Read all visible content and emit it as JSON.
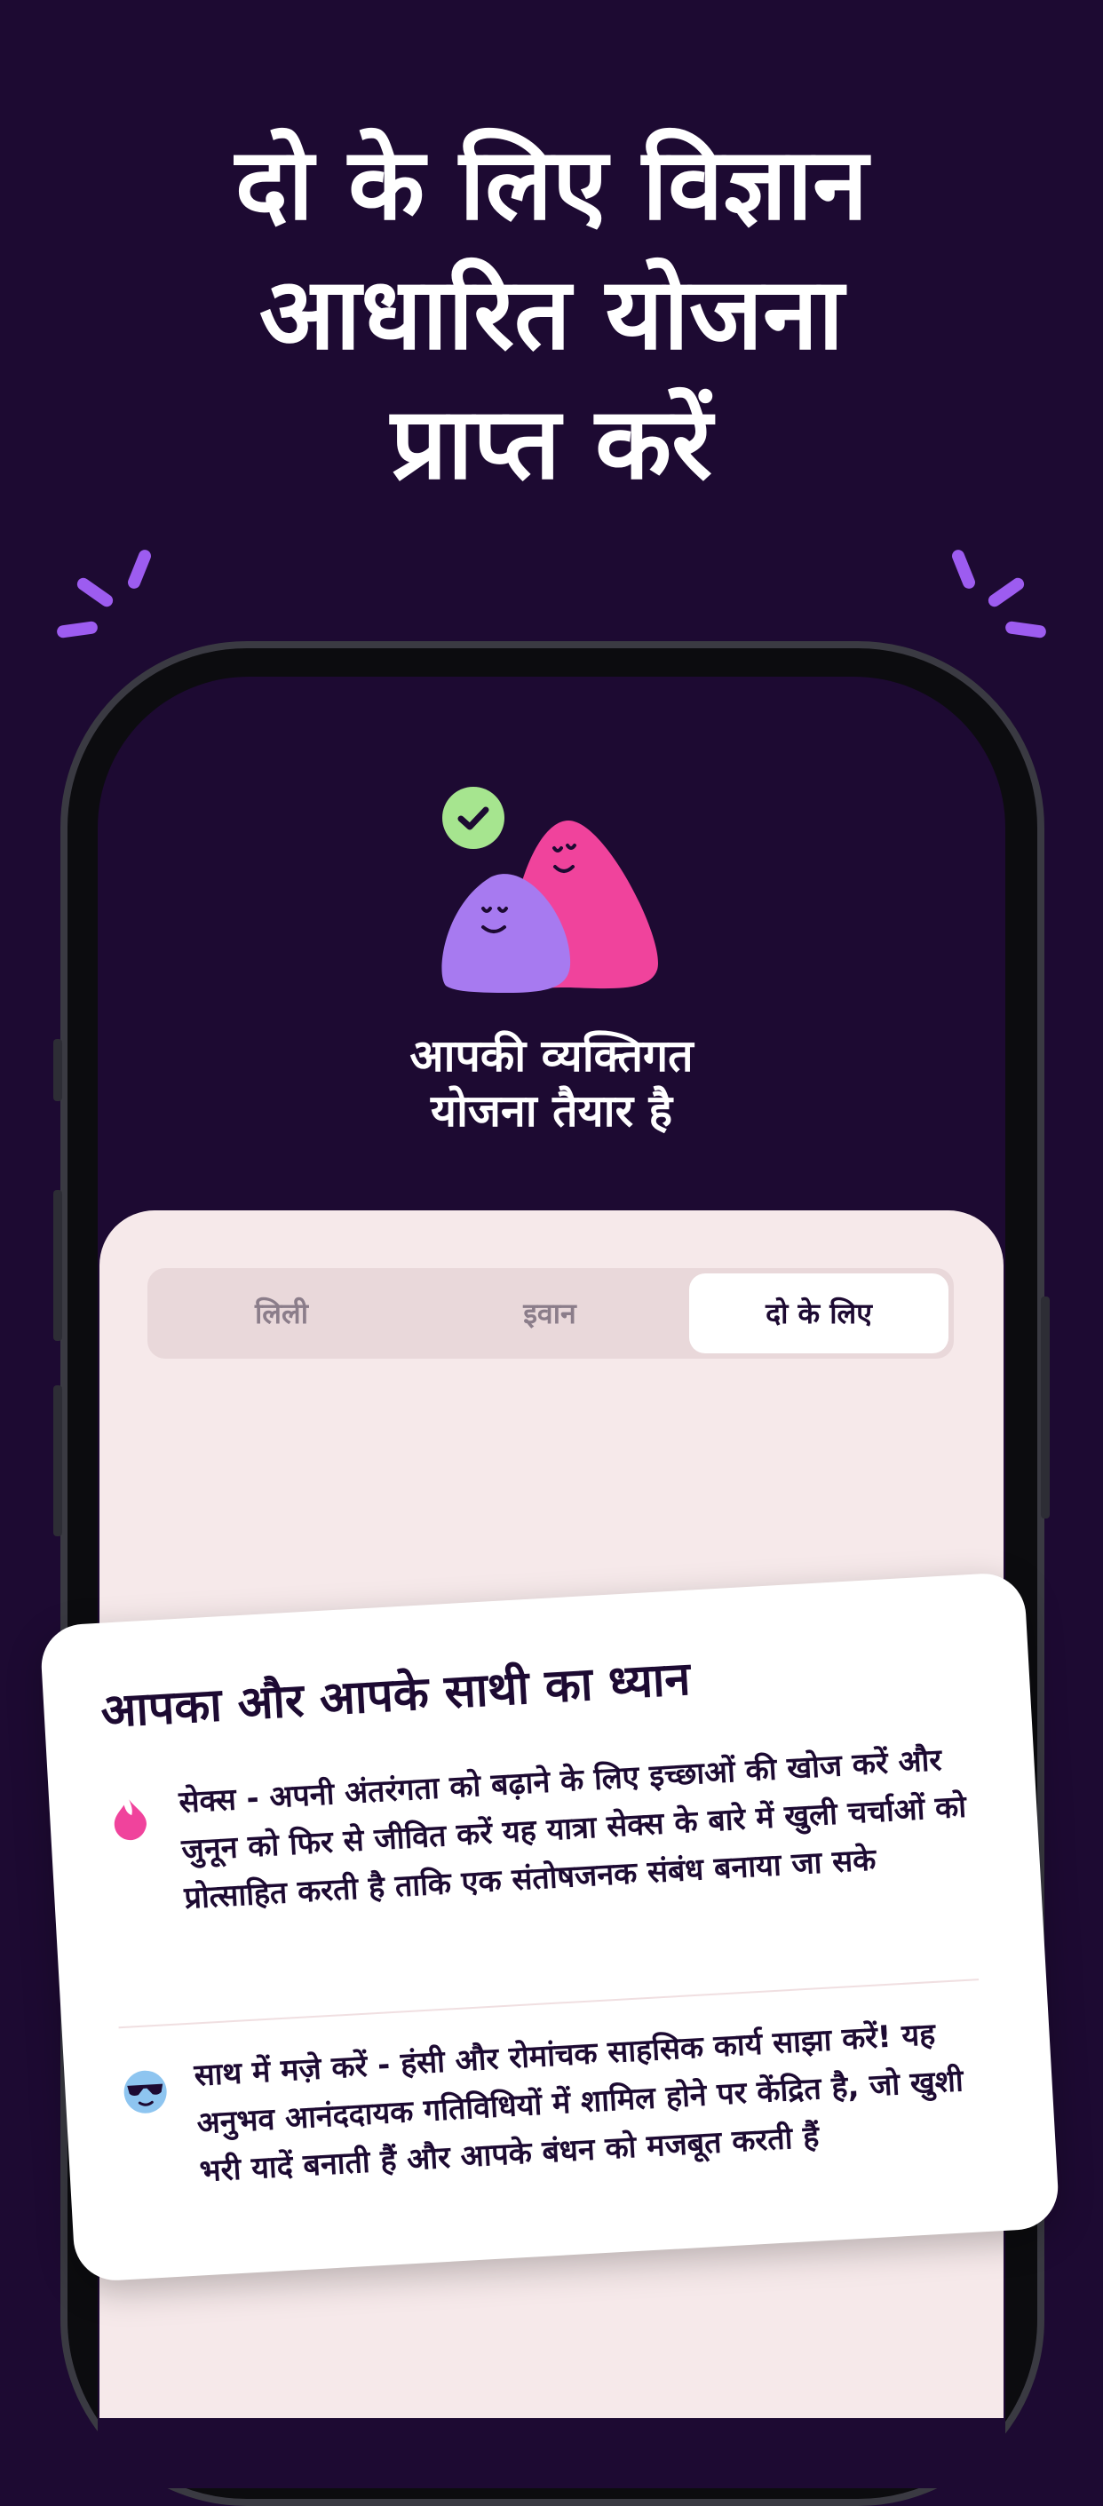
{
  "headline": {
    "line1": "दो के लिए विज्ञान",
    "line2": "आधारित योजना",
    "line3": "प्राप्त करें"
  },
  "plan": {
    "title_line1": "आपकी व्यक्तिगत",
    "title_line2": "योजना तैयार है"
  },
  "tabs": [
    {
      "label": "लिली",
      "active": false
    },
    {
      "label": "इवान",
      "active": false
    },
    {
      "label": "दो के लिए",
      "active": true
    }
  ],
  "card": {
    "title": "आपका और आपके साथी का ध्यान",
    "items": [
      {
        "icon": "flame-icon",
        "text": "सेक्स - अपनी अंतरंगता को बढ़ाने के लिए इच्छाओं की खोज करें और जुनून को फिर से जीवित करें  यह यात्रा सेक्स के बारे में खुली चर्चाओं को प्रोत्साहित करती है ताकि एक संतोषजनक संबंध बनाया जा सके"
      },
      {
        "icon": "cool-face-icon",
        "text": "साथ में मज़े करें - हंसी और रोमांचक साहसिक कार्य साझा करें! यह अनुभव आनंददायक गतिविधियों में शामिल होने पर केंद्रित है, जो खुशी भरी यादें बनाती हैं और आपके बंधन को मजबूत करती हैं"
      }
    ]
  },
  "colors": {
    "background": "#1d0a32",
    "sparkle": "#9d5cf0",
    "check_badge": "#a6e58f",
    "blob_purple": "#a77af0",
    "blob_pink": "#f0439c",
    "sheet": "#f6e9ea",
    "flame": "#f0439c",
    "cool_face": "#8ec5f0"
  }
}
